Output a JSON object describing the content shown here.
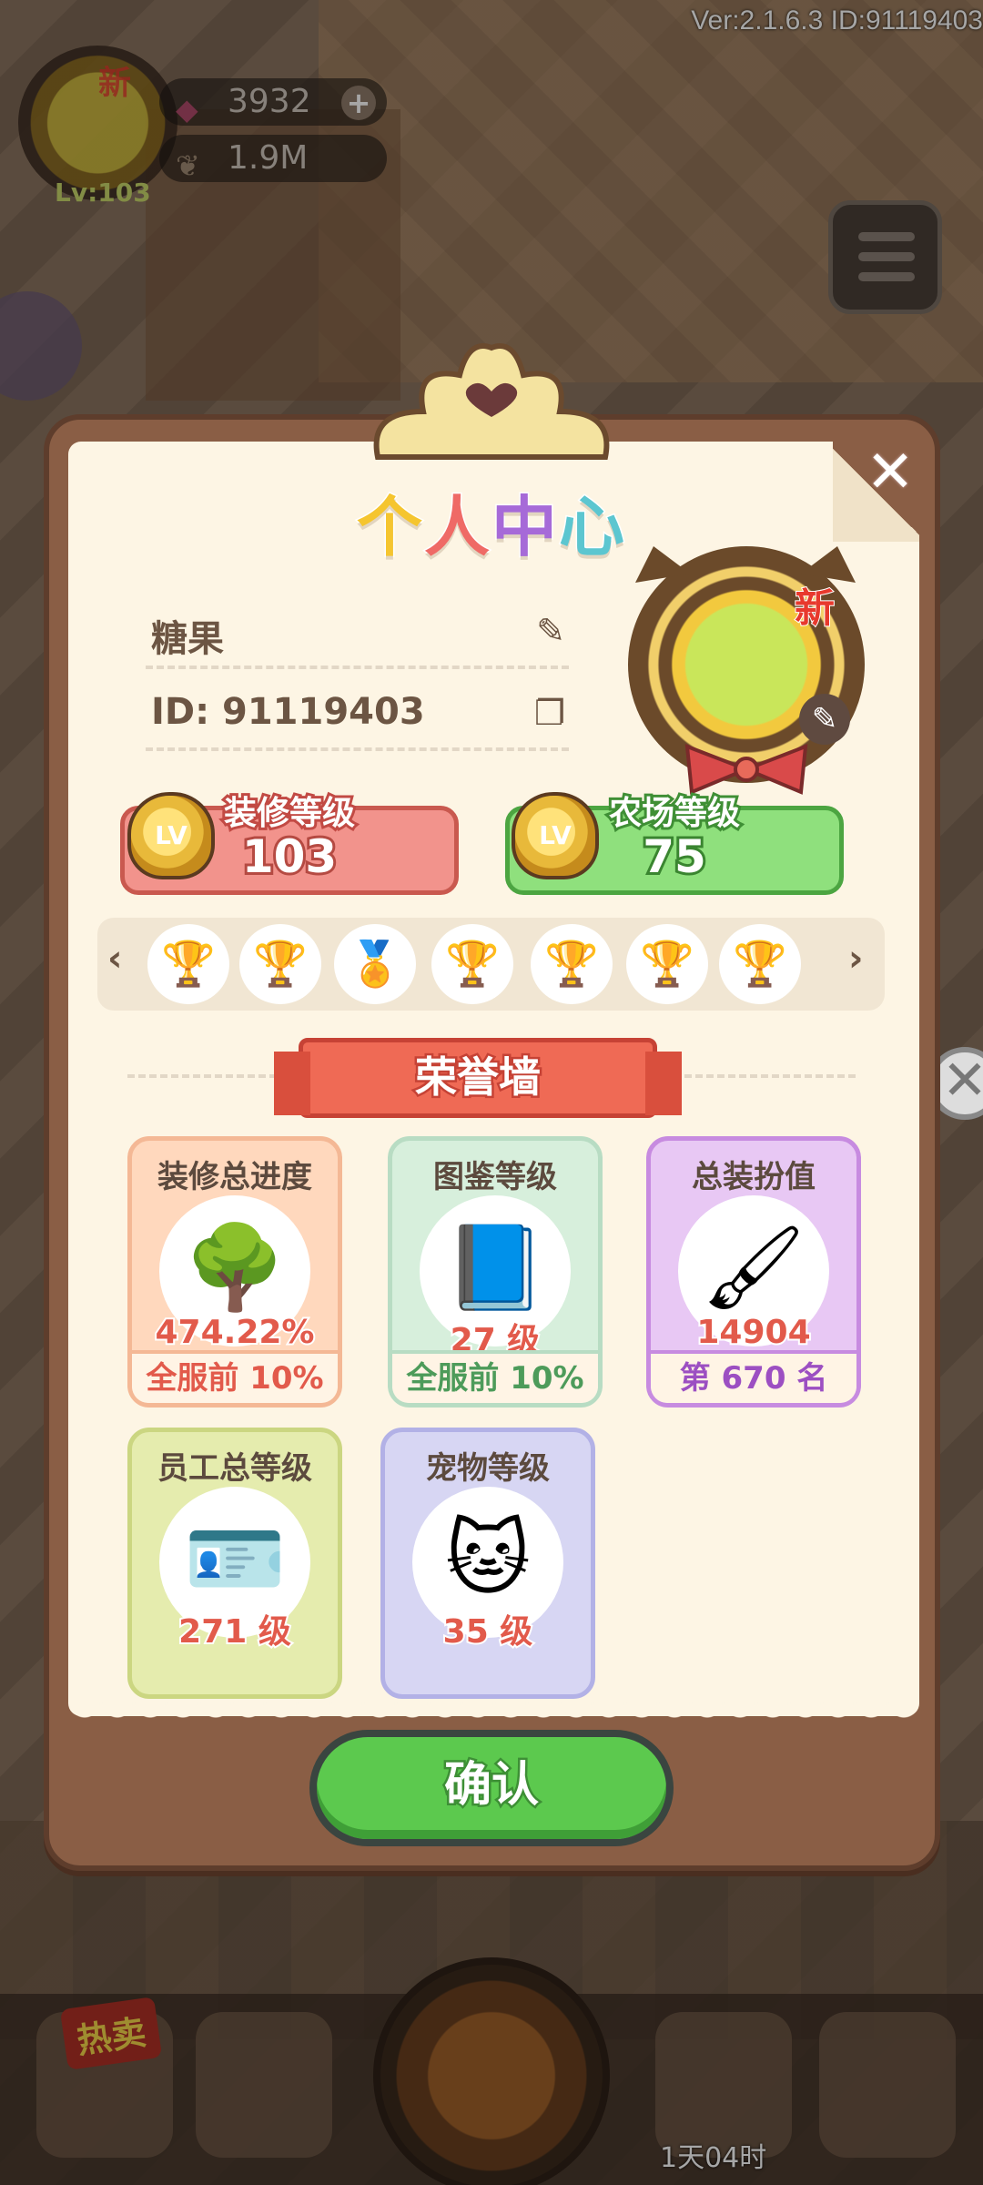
{
  "version_text": "Ver:2.1.6.3 ID:91119403",
  "hud": {
    "new_badge": "新",
    "level": "Lv:103",
    "gems": "3932",
    "seeds": "1.9M",
    "plus": "+"
  },
  "dialog": {
    "title_chars": [
      "个",
      "人",
      "中",
      "心"
    ],
    "name": "糖果",
    "id_text": "ID: 91119403",
    "avatar_new": "新",
    "deco_level": {
      "label": "装修等级",
      "value": "103",
      "badge": "LV"
    },
    "farm_level": {
      "label": "农场等级",
      "value": "75",
      "badge": "LV"
    },
    "trophies": [
      "🏆",
      "🏆",
      "🏅",
      "🏆",
      "🏆",
      "🏆",
      "🏆",
      "🏆"
    ],
    "honor_title": "荣誉墙",
    "cards": [
      {
        "title": "装修总进度",
        "icon": "tree-icon",
        "glyph": "🌳",
        "value": "474.22%",
        "rank": "全服前 10%"
      },
      {
        "title": "图鉴等级",
        "icon": "book-icon",
        "glyph": "📘",
        "value": "27 级",
        "rank": "全服前 10%"
      },
      {
        "title": "总装扮值",
        "icon": "paint-roller-icon",
        "glyph": "🖌",
        "value": "14904",
        "rank": "第 670 名"
      },
      {
        "title": "员工总等级",
        "icon": "id-card-icon",
        "glyph": "🪪",
        "value": "271 级"
      },
      {
        "title": "宠物等级",
        "icon": "pet-icon",
        "glyph": "🐱",
        "value": "35 级"
      }
    ],
    "confirm_label": "确认",
    "close_glyph": "✕"
  },
  "bottom_bar": {
    "hot_label": "热卖",
    "timer": "1天04时"
  },
  "colors": {
    "paper": "#fdf5e4",
    "frame": "#8a5e45",
    "deco_box": "#f2938c",
    "farm_box": "#8fe07d",
    "honor_banner": "#ef6a55",
    "confirm": "#5cc94e"
  }
}
